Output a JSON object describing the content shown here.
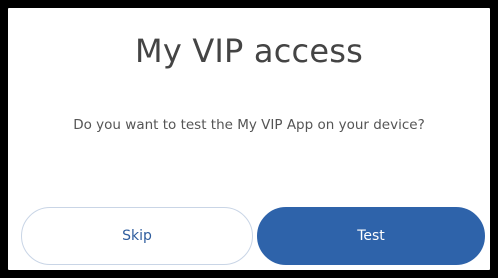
{
  "dialog": {
    "title": "My VIP access",
    "message": "Do you want to test the My VIP App on your device?",
    "buttons": {
      "skip_label": "Skip",
      "test_label": "Test"
    }
  },
  "colors": {
    "primary": "#2e63aa",
    "secondary_border": "#c9d5e6",
    "frame": "#000000"
  }
}
